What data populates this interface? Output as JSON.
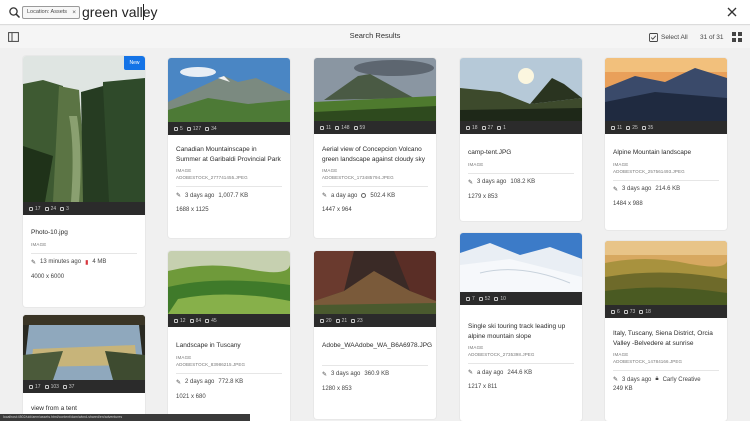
{
  "search": {
    "chip_label": "Location: Assets",
    "chip_close": "×",
    "query": "green valley"
  },
  "toolbar": {
    "title": "Search Results",
    "select_all": "Select All",
    "count": "31 of 31"
  },
  "cards": [
    {
      "title": "Photo-10.jpg",
      "type": "IMAGE",
      "file": "",
      "time": "13 minutes ago",
      "size": "4 MB",
      "dims": "4000 x 6000",
      "stats": [
        "17",
        "24",
        "3"
      ],
      "badge": "New",
      "size_icon": "pdf-icon"
    },
    {
      "title": "Canadian Mountainscape in Summer at Garibaldi Provincial Park",
      "type": "IMAGE",
      "file": "ADOBESTOCK_277741455.JPEG",
      "time": "3 days ago",
      "size": "1,007.7 KB",
      "dims": "1688 x 1125",
      "stats": [
        "5",
        "127",
        "34"
      ]
    },
    {
      "title": "Aerial view of Concepcion Volcano green landscape against cloudy sky",
      "type": "IMAGE",
      "file": "ADOBESTOCK_173485794.JPEG",
      "time": "a day ago",
      "size": "502.4 KB",
      "dims": "1447 x 964",
      "stats": [
        "11",
        "148",
        "59"
      ]
    },
    {
      "title": "camp-tent.JPG",
      "type": "IMAGE",
      "file": "",
      "time": "3 days ago",
      "size": "108.2 KB",
      "dims": "1279 x 853",
      "stats": [
        "18",
        "27",
        "1"
      ]
    },
    {
      "title": "Alpine Mountain landscape",
      "type": "IMAGE",
      "file": "ADOBESTOCK_257561493.JPEG",
      "time": "3 days ago",
      "size": "214.6 KB",
      "dims": "1484 x 988",
      "stats": [
        "11",
        "25",
        "35"
      ]
    },
    {
      "title": "view from a tent",
      "type": "",
      "file": "",
      "time": "",
      "size": "",
      "dims": "",
      "stats": [
        "17",
        "103",
        "37"
      ]
    },
    {
      "title": "Landscape in Tuscany",
      "type": "IMAGE",
      "file": "ADOBESTOCK_83986215.JPEG",
      "time": "2 days ago",
      "size": "772.8 KB",
      "dims": "1021 x 680",
      "stats": [
        "12",
        "84",
        "45"
      ]
    },
    {
      "title": "Adobe_WAAdobe_WA_B6A6978.JPG",
      "type": "",
      "file": "",
      "time": "3 days ago",
      "size": "360.9 KB",
      "dims": "1280 x 853",
      "stats": [
        "20",
        "21",
        "23"
      ]
    },
    {
      "title": "Single ski touring track leading up alpine mountain slope",
      "type": "IMAGE",
      "file": "ADOBESTOCK_2735398.JPEG",
      "time": "a day ago",
      "size": "244.6 KB",
      "dims": "1217 x 811",
      "stats": [
        "7",
        "52",
        "10"
      ]
    },
    {
      "title": "Italy, Tuscany, Siena District, Orcia Valley -Belvedere at sunrise",
      "type": "IMAGE",
      "file": "ADOBESTOCK_14784166.JPEG",
      "time": "3 days ago",
      "size": "249 KB",
      "author": "Carly Creative",
      "dims": "",
      "stats": [
        "6",
        "73",
        "18"
      ]
    }
  ],
  "status_url": "localhost:4502/ui#/aem/assets.html/content/dam/wknd-shared/en/adventures"
}
